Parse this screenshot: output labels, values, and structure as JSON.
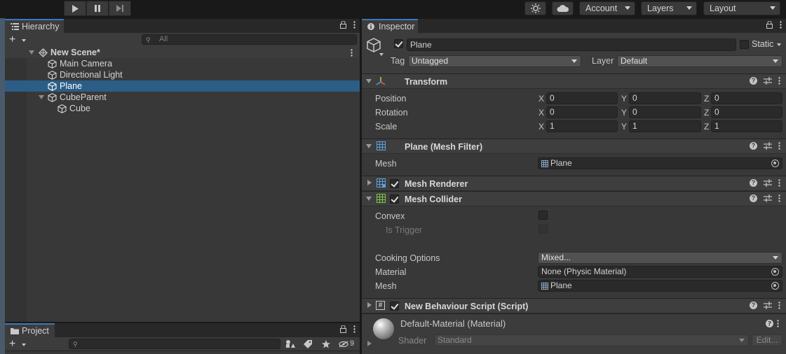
{
  "toolbar": {
    "account": "Account",
    "layers": "Layers",
    "layout": "Layout"
  },
  "hierarchy": {
    "tab_label": "Hierarchy",
    "search_placeholder": "All",
    "scene_name": "New Scene*",
    "items": [
      {
        "label": "Main Camera"
      },
      {
        "label": "Directional Light"
      },
      {
        "label": "Plane"
      },
      {
        "label": "CubeParent"
      },
      {
        "label": "Cube"
      }
    ]
  },
  "project": {
    "tab_label": "Project",
    "hidden_count": "9"
  },
  "inspector": {
    "tab_label": "Inspector",
    "object_name": "Plane",
    "static_label": "Static",
    "tag_label": "Tag",
    "tag_value": "Untagged",
    "layer_label": "Layer",
    "layer_value": "Default",
    "transform": {
      "title": "Transform",
      "position_label": "Position",
      "rotation_label": "Rotation",
      "scale_label": "Scale",
      "axis_x": "X",
      "axis_y": "Y",
      "axis_z": "Z",
      "position": [
        "0",
        "0",
        "0"
      ],
      "rotation": [
        "0",
        "0",
        "0"
      ],
      "scale": [
        "1",
        "1",
        "1"
      ]
    },
    "mesh_filter": {
      "title": "Plane (Mesh Filter)",
      "mesh_label": "Mesh",
      "mesh_value": "Plane"
    },
    "mesh_renderer": {
      "title": "Mesh Renderer"
    },
    "mesh_collider": {
      "title": "Mesh Collider",
      "convex_label": "Convex",
      "is_trigger_label": "Is Trigger",
      "cooking_label": "Cooking Options",
      "cooking_value": "Mixed...",
      "material_label": "Material",
      "material_value": "None (Physic Material)",
      "mesh_label": "Mesh",
      "mesh_value": "Plane"
    },
    "script": {
      "title": "New Behaviour Script (Script)"
    },
    "material": {
      "title": "Default-Material (Material)",
      "shader_label": "Shader",
      "shader_value": "Standard",
      "edit_label": "Edit..."
    }
  }
}
